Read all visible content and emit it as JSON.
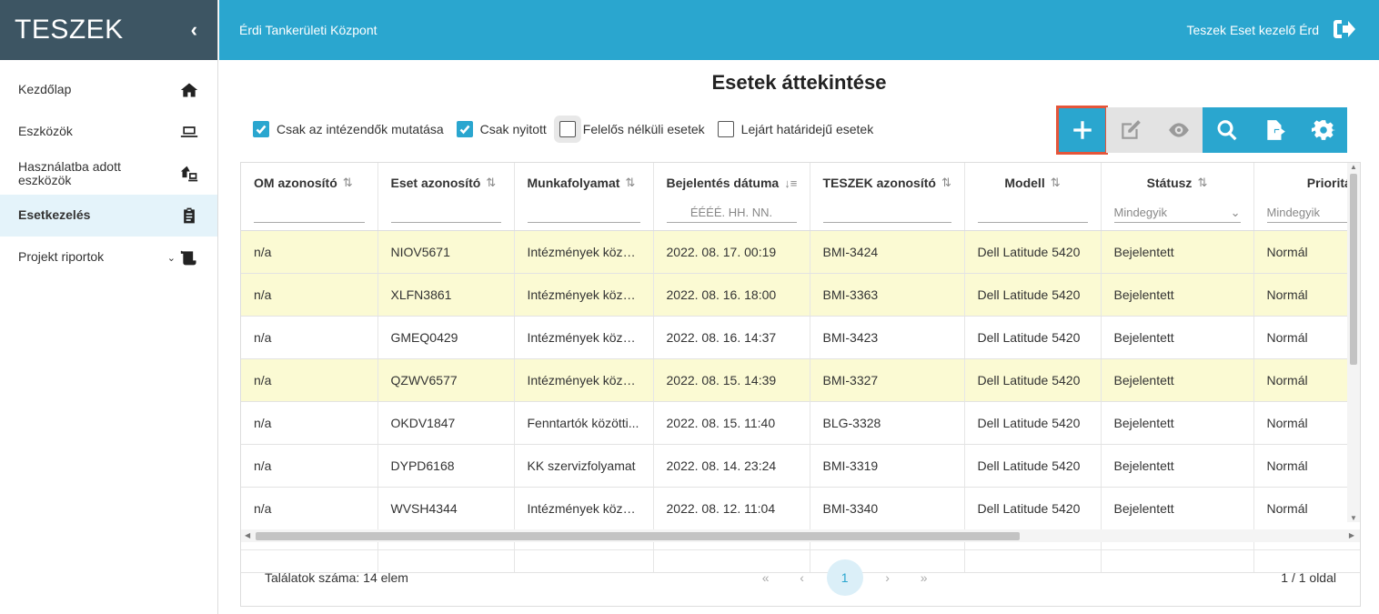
{
  "sidebar": {
    "logo": "TESZEK",
    "collapse_icon": "chevron-left",
    "items": [
      {
        "label": "Kezdőlap",
        "icon": "home"
      },
      {
        "label": "Eszközök",
        "icon": "laptop"
      },
      {
        "label": "Használatba adott eszközök",
        "icon": "house-laptop"
      },
      {
        "label": "Esetkezelés",
        "icon": "clipboard",
        "active": true
      },
      {
        "label": "Projekt riportok",
        "icon": "scroll",
        "expandable": true
      }
    ]
  },
  "header": {
    "org": "Érdi Tankerületi Központ",
    "user": "Teszek Eset kezelő Érd",
    "logout_icon": "sign-out"
  },
  "page": {
    "title": "Esetek áttekintése",
    "filters": [
      {
        "label": "Csak az intézendők mutatása",
        "checked": true
      },
      {
        "label": "Csak nyitott",
        "checked": true
      },
      {
        "label": "Felelős nélküli esetek",
        "checked": false
      },
      {
        "label": "Lejárt határidejű esetek",
        "checked": false
      }
    ],
    "toolbar": [
      "add",
      "edit",
      "view",
      "search",
      "export",
      "settings"
    ]
  },
  "table": {
    "columns": [
      {
        "label": "OM azonosító",
        "sort": "⇅"
      },
      {
        "label": "Eset azonosító",
        "sort": "⇅"
      },
      {
        "label": "Munkafolyamat",
        "sort": "⇅"
      },
      {
        "label": "Bejelentés dátuma",
        "sort": "↓≡",
        "filter_placeholder": "ÉÉÉÉ. HH. NN."
      },
      {
        "label": "TESZEK azonosító",
        "sort": "⇅"
      },
      {
        "label": "Modell",
        "sort": "⇅"
      },
      {
        "label": "Státusz",
        "sort": "⇅",
        "filter_select": "Mindegyik"
      },
      {
        "label": "Prioritás",
        "sort": "⇅",
        "filter_select": "Mindegyik"
      }
    ],
    "rows": [
      {
        "hl": true,
        "cells": [
          "n/a",
          "NIOV5671",
          "Intézmények közö...",
          "2022. 08. 17. 00:19",
          "BMI-3424",
          "Dell Latitude 5420",
          "Bejelentett",
          "Normál"
        ]
      },
      {
        "hl": true,
        "cells": [
          "n/a",
          "XLFN3861",
          "Intézmények közö...",
          "2022. 08. 16. 18:00",
          "BMI-3363",
          "Dell Latitude 5420",
          "Bejelentett",
          "Normál"
        ]
      },
      {
        "hl": false,
        "cells": [
          "n/a",
          "GMEQ0429",
          "Intézmények közö...",
          "2022. 08. 16. 14:37",
          "BMI-3423",
          "Dell Latitude 5420",
          "Bejelentett",
          "Normál"
        ]
      },
      {
        "hl": true,
        "cells": [
          "n/a",
          "QZWV6577",
          "Intézmények közö...",
          "2022. 08. 15. 14:39",
          "BMI-3327",
          "Dell Latitude 5420",
          "Bejelentett",
          "Normál"
        ]
      },
      {
        "hl": false,
        "cells": [
          "n/a",
          "OKDV1847",
          "Fenntartók közötti...",
          "2022. 08. 15. 11:40",
          "BLG-3328",
          "Dell Latitude 5420",
          "Bejelentett",
          "Normál"
        ]
      },
      {
        "hl": false,
        "cells": [
          "n/a",
          "DYPD6168",
          "KK szervizfolyamat",
          "2022. 08. 14. 23:24",
          "BMI-3319",
          "Dell Latitude 5420",
          "Bejelentett",
          "Normál"
        ]
      },
      {
        "hl": false,
        "cells": [
          "n/a",
          "WVSH4344",
          "Intézmények közö...",
          "2022. 08. 12. 11:04",
          "BMI-3340",
          "Dell Latitude 5420",
          "Bejelentett",
          "Normál"
        ]
      },
      {
        "hl": false,
        "cells": [
          "",
          "",
          "",
          "",
          "",
          "",
          "",
          ""
        ]
      }
    ]
  },
  "pager": {
    "total": "Találatok száma: 14 elem",
    "first": "«",
    "prev": "‹",
    "current": "1",
    "next": "›",
    "last": "»",
    "page_info": "1 / 1 oldal"
  }
}
